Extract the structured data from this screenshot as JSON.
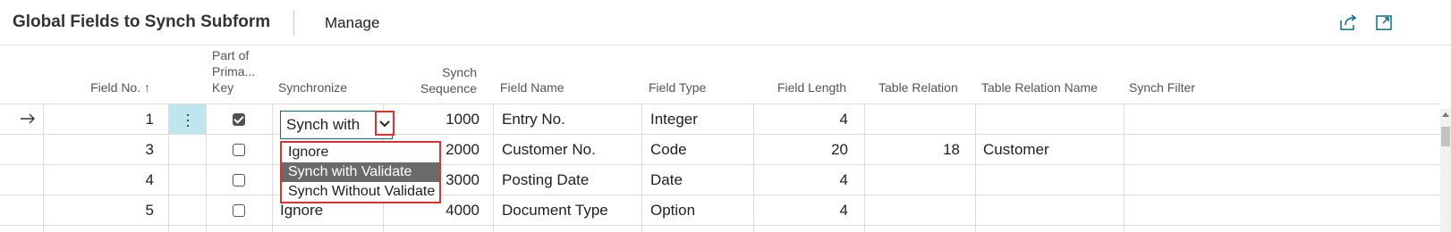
{
  "header": {
    "title": "Global Fields to Synch Subform",
    "manage_label": "Manage",
    "share_icon": "share-icon",
    "expand_icon": "expand-icon"
  },
  "columns": {
    "field_no": "Field No. ↑",
    "part_of_key": [
      "Part of",
      "Prima...",
      "Key"
    ],
    "synchronize": "Synchronize",
    "synch_sequence": [
      "Synch",
      "Sequence"
    ],
    "field_name": "Field Name",
    "field_type": "Field Type",
    "field_length": "Field Length",
    "table_relation": "Table Relation",
    "table_relation_name": "Table Relation Name",
    "synch_filter": "Synch Filter"
  },
  "rows": [
    {
      "field_no": "1",
      "part_of_key": true,
      "synchronize": "Synch with",
      "synch_sequence": "1000",
      "field_name": "Entry No.",
      "field_type": "Integer",
      "field_length": "4",
      "table_relation": "",
      "table_relation_name": "",
      "synch_filter": ""
    },
    {
      "field_no": "3",
      "part_of_key": false,
      "synchronize": "",
      "synch_sequence": "2000",
      "field_name": "Customer No.",
      "field_type": "Code",
      "field_length": "20",
      "table_relation": "18",
      "table_relation_name": "Customer",
      "synch_filter": ""
    },
    {
      "field_no": "4",
      "part_of_key": false,
      "synchronize": "",
      "synch_sequence": "3000",
      "field_name": "Posting Date",
      "field_type": "Date",
      "field_length": "4",
      "table_relation": "",
      "table_relation_name": "",
      "synch_filter": ""
    },
    {
      "field_no": "5",
      "part_of_key": false,
      "synchronize": "Ignore",
      "synch_sequence": "4000",
      "field_name": "Document Type",
      "field_type": "Option",
      "field_length": "4",
      "table_relation": "",
      "table_relation_name": "",
      "synch_filter": ""
    }
  ],
  "dropdown": {
    "options": [
      "Ignore",
      "Synch with Validate",
      "Synch Without Validate"
    ],
    "selected": "Synch with Validate"
  },
  "colors": {
    "accent": "#0a6e8a",
    "highlight_border": "#e03030",
    "selected_option_bg": "#6a6a6a",
    "row_menu_bg": "#bfe6ee"
  }
}
